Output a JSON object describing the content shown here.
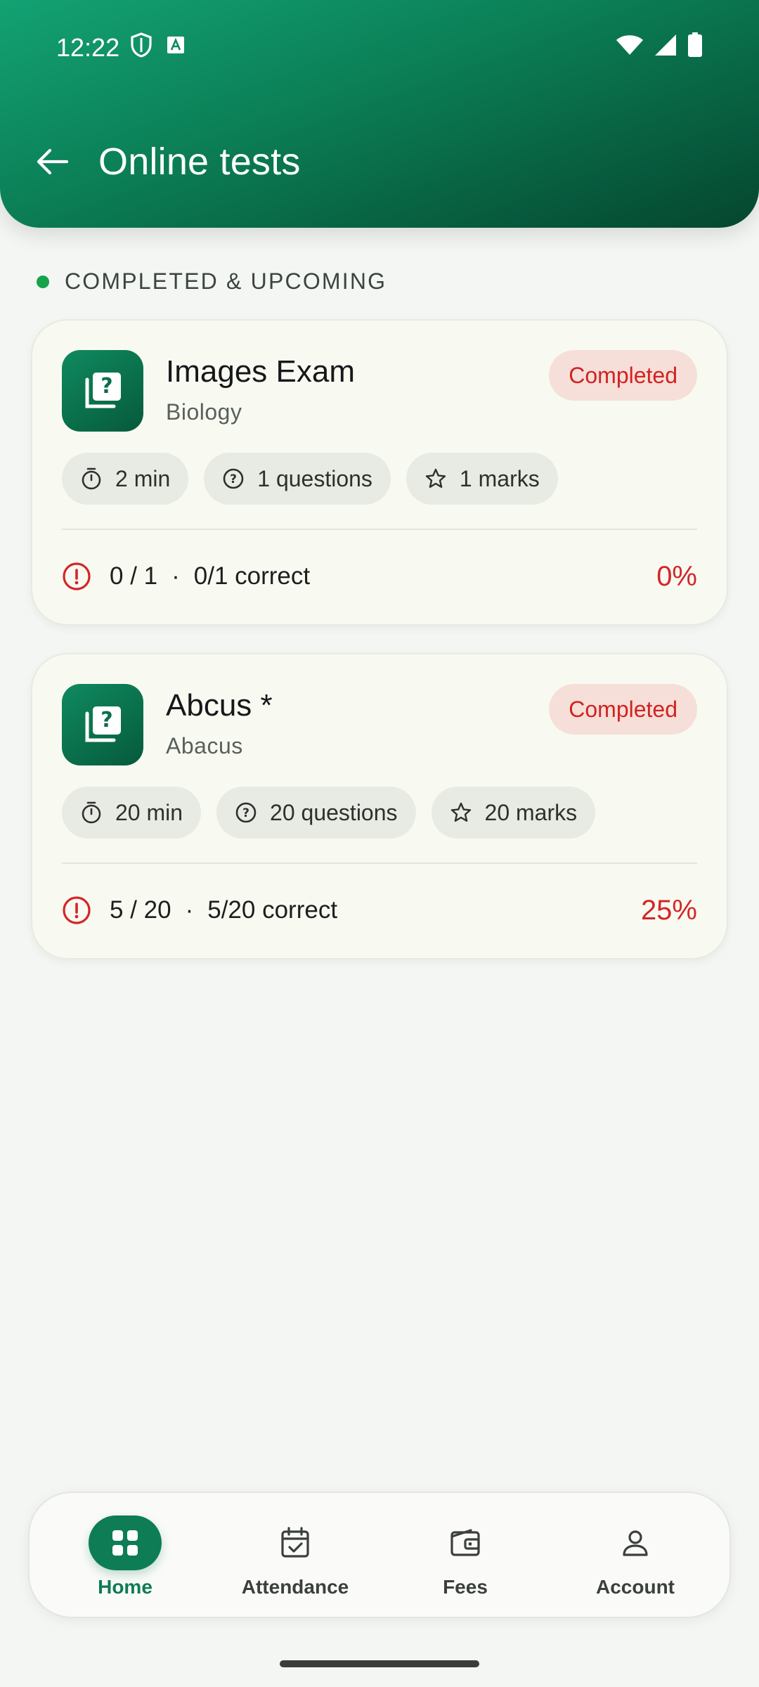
{
  "status_bar": {
    "time": "12:22"
  },
  "header": {
    "title": "Online tests"
  },
  "section": {
    "label": "COMPLETED & UPCOMING"
  },
  "tests": [
    {
      "title": "Images Exam",
      "subject": "Biology",
      "status": "Completed",
      "duration": "2 min",
      "questions": "1 questions",
      "marks": "1 marks",
      "score": "0 / 1",
      "correct": "0/1 correct",
      "percent": "0%"
    },
    {
      "title": "Abcus *",
      "subject": "Abacus",
      "status": "Completed",
      "duration": "20 min",
      "questions": "20 questions",
      "marks": "20 marks",
      "score": "5 / 20",
      "correct": "5/20 correct",
      "percent": "25%"
    }
  ],
  "bottom_nav": {
    "items": [
      {
        "label": "Home",
        "icon": "grid-icon",
        "active": true
      },
      {
        "label": "Attendance",
        "icon": "calendar-check-icon",
        "active": false
      },
      {
        "label": "Fees",
        "icon": "wallet-icon",
        "active": false
      },
      {
        "label": "Account",
        "icon": "person-icon",
        "active": false
      }
    ]
  },
  "colors": {
    "brand": "#0e7c55",
    "status_red": "#d32222",
    "badge_bg": "#f6dfd9"
  }
}
